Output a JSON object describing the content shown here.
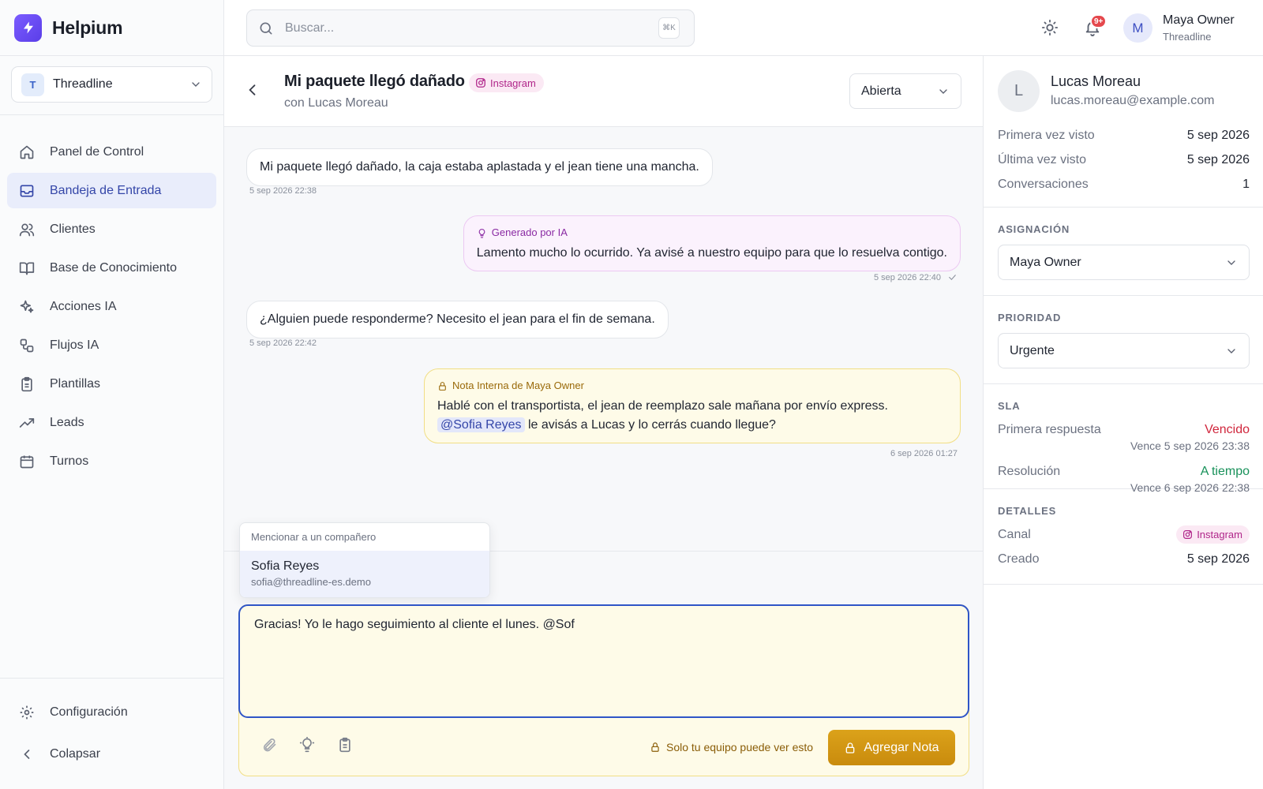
{
  "app": {
    "name": "Helpium"
  },
  "workspace": {
    "initial": "T",
    "name": "Threadline"
  },
  "sidebar": {
    "items": [
      {
        "label": "Panel de Control",
        "icon": "home-icon"
      },
      {
        "label": "Bandeja de Entrada",
        "icon": "inbox-icon",
        "active": true
      },
      {
        "label": "Clientes",
        "icon": "users-icon"
      },
      {
        "label": "Base de Conocimiento",
        "icon": "book-icon"
      },
      {
        "label": "Acciones IA",
        "icon": "sparkles-icon"
      },
      {
        "label": "Flujos IA",
        "icon": "workflow-icon"
      },
      {
        "label": "Plantillas",
        "icon": "clipboard-icon"
      },
      {
        "label": "Leads",
        "icon": "trending-up-icon"
      },
      {
        "label": "Turnos",
        "icon": "calendar-icon"
      }
    ],
    "settings_label": "Configuración",
    "collapse_label": "Colapsar"
  },
  "topbar": {
    "search_placeholder": "Buscar...",
    "shortcut": "⌘K",
    "notification_count": "9+",
    "user": {
      "initial": "M",
      "name": "Maya Owner",
      "org": "Threadline"
    }
  },
  "conversation": {
    "title": "Mi paquete llegó dañado",
    "channel": "Instagram",
    "subtitle": "con Lucas Moreau",
    "status": "Abierta",
    "messages": [
      {
        "type": "incoming",
        "text": "Mi paquete llegó dañado, la caja estaba aplastada y el jean tiene una mancha.",
        "time": "5 sep 2026 22:38"
      },
      {
        "type": "ai",
        "tag": "Generado por IA",
        "text": "Lamento mucho lo ocurrido. Ya avisé a nuestro equipo para que lo resuelva contigo.",
        "time": "5 sep 2026 22:40"
      },
      {
        "type": "incoming",
        "text": "¿Alguien puede responderme? Necesito el jean para el fin de semana.",
        "time": "5 sep 2026 22:42"
      },
      {
        "type": "note",
        "tag": "Nota Interna de Maya Owner",
        "line1": "Hablé con el transportista, el jean de reemplazo sale mañana por envío express.",
        "mention": "@Sofia Reyes",
        "line2": " le avisás a Lucas y lo cerrás cuando llegue?",
        "time": "6 sep 2026 01:27"
      }
    ],
    "mention_popup": {
      "header": "Mencionar a un compañero",
      "option_name": "Sofia Reyes",
      "option_email": "sofia@threadline-es.demo"
    },
    "composer": {
      "value": "Gracias! Yo le hago seguimiento al cliente el lunes. @Sof",
      "privacy_note": "Solo tu equipo puede ver esto",
      "submit_label": "Agregar Nota"
    }
  },
  "contact": {
    "initial": "L",
    "name": "Lucas Moreau",
    "email": "lucas.moreau@example.com",
    "first_seen_label": "Primera vez visto",
    "first_seen": "5 sep 2026",
    "last_seen_label": "Última vez visto",
    "last_seen": "5 sep 2026",
    "conversations_label": "Conversaciones",
    "conversations": "1"
  },
  "assignment": {
    "title": "ASIGNACIÓN",
    "value": "Maya Owner"
  },
  "priority": {
    "title": "PRIORIDAD",
    "value": "Urgente"
  },
  "sla": {
    "title": "SLA",
    "first_response_label": "Primera respuesta",
    "first_response_status": "Vencido",
    "first_response_due": "Vence 5 sep 2026 23:38",
    "resolution_label": "Resolución",
    "resolution_status": "A tiempo",
    "resolution_due": "Vence 6 sep 2026 22:38"
  },
  "details": {
    "title": "DETALLES",
    "channel_label": "Canal",
    "channel": "Instagram",
    "created_label": "Creado",
    "created": "5 sep 2026"
  },
  "colors": {
    "primary": "#3446a8",
    "brand": "#6a4cf5",
    "note": "#fefbe8",
    "ai": "#fbf2fd",
    "note_button": "#d39a14",
    "danger": "#d0263c",
    "success": "#18915a"
  }
}
